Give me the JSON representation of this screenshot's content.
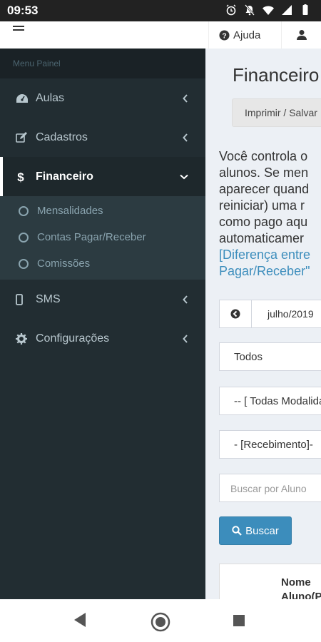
{
  "status_bar": {
    "time": "09:53"
  },
  "topbar": {
    "help_label": "Ajuda"
  },
  "sidebar": {
    "header": "Menu Painel",
    "items": [
      {
        "label": "Aulas"
      },
      {
        "label": "Cadastros"
      },
      {
        "label": "Financeiro"
      },
      {
        "label": "SMS"
      },
      {
        "label": "Configurações"
      }
    ],
    "financeiro_submenu": [
      {
        "label": "Mensalidades"
      },
      {
        "label": "Contas Pagar/Receber"
      },
      {
        "label": "Comissões"
      }
    ]
  },
  "main": {
    "title": "Financeiro",
    "print_button": "Imprimir / Salvar",
    "description_lines": [
      "Você controla o",
      "alunos. Se men",
      "aparecer quand",
      "reiniciar) uma r",
      "como pago aqu",
      "automaticamer"
    ],
    "description_link_lines": [
      "[Diferença entre",
      "Pagar/Receber\""
    ],
    "month_value": "julho/2019",
    "filters": {
      "status": "Todos",
      "modalidade": "-- [ Todas Modalidades",
      "tipo": "- [Recebimento]-",
      "search_placeholder": "Buscar por Aluno"
    },
    "search_button": "Buscar",
    "table_header": [
      "Nome",
      "Aluno(P"
    ]
  },
  "colors": {
    "sidebar_bg": "#222d32",
    "submenu_bg": "#2c3b41",
    "accent_blue": "#3c8dbc",
    "content_bg": "#ecf0f5"
  }
}
